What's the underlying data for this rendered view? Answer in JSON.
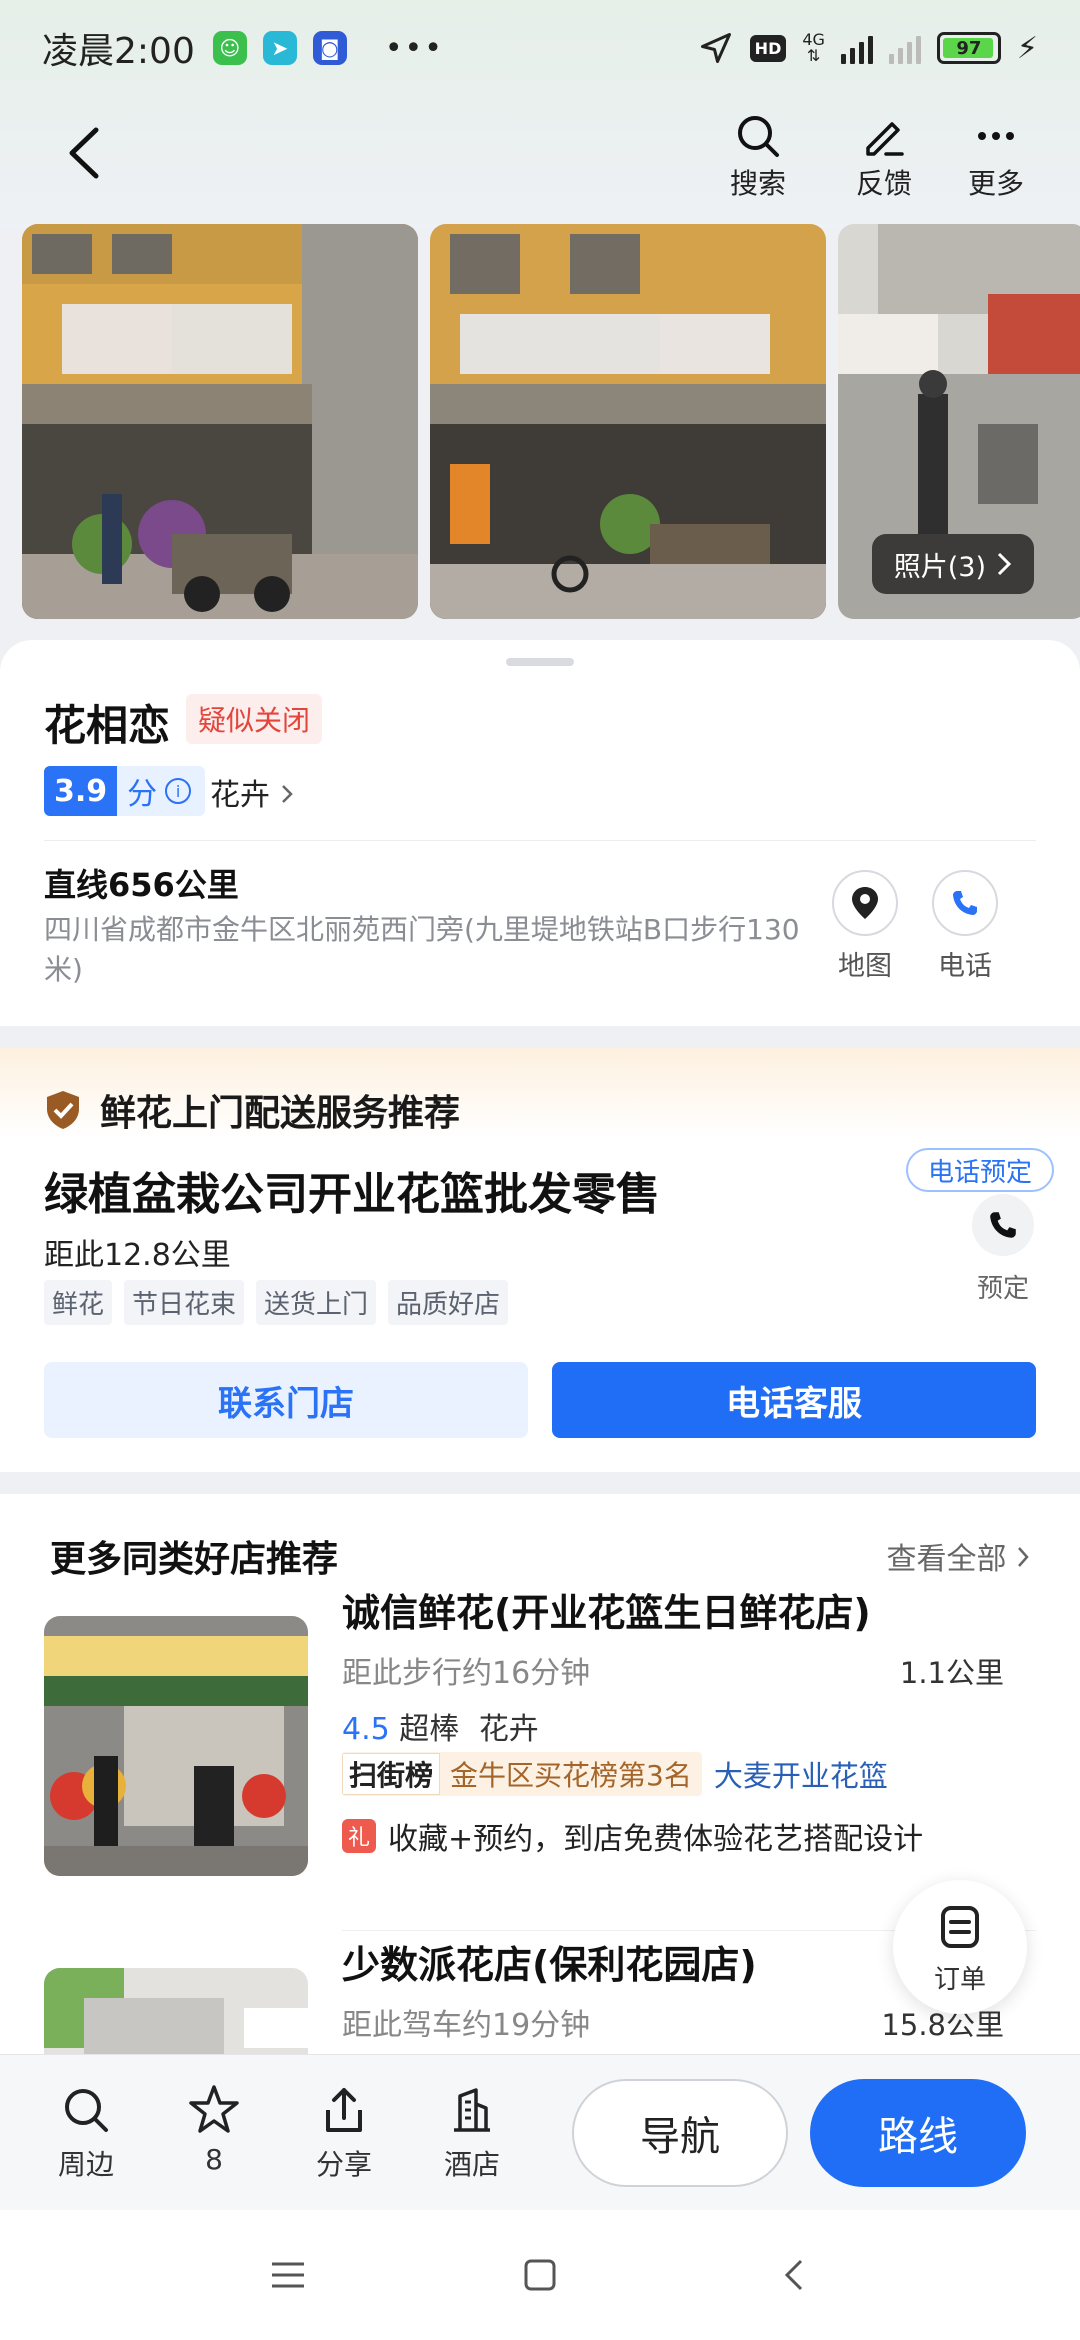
{
  "status_bar": {
    "time": "凌晨2:00",
    "more": "•••",
    "network": "4G",
    "hd": "HD",
    "battery": "97"
  },
  "header": {
    "actions": [
      {
        "label": "搜索",
        "icon": "search-icon"
      },
      {
        "label": "反馈",
        "icon": "edit-icon"
      },
      {
        "label": "更多",
        "icon": "more-icon"
      }
    ]
  },
  "photos": {
    "count_label": "照片(3)"
  },
  "place": {
    "name": "花相恋",
    "status_badge": "疑似关闭",
    "rating_score": "3.9",
    "rating_unit": "分",
    "category": "花卉",
    "distance": "直线656公里",
    "address": "四川省成都市金牛区北丽苑西门旁(九里堤地铁站B口步行130米)",
    "actions": [
      {
        "label": "地图",
        "icon": "location-pin-icon"
      },
      {
        "label": "电话",
        "icon": "phone-icon"
      }
    ]
  },
  "promo": {
    "header": "鲜花上门配送服务推荐",
    "title": "绿植盆栽公司开业花篮批发零售",
    "distance": "距此12.8公里",
    "tags": [
      "鲜花",
      "节日花束",
      "送货上门",
      "品质好店"
    ],
    "phone_reserve_badge": "电话预定",
    "reserve_label": "预定",
    "contact_button": "联系门店",
    "call_button": "电话客服"
  },
  "recommendations": {
    "title": "更多同类好店推荐",
    "view_all": "查看全部",
    "items": [
      {
        "name": "诚信鲜花(开业花篮生日鲜花店)",
        "subtitle": "距此步行约16分钟",
        "distance": "1.1公里",
        "score": "4.5",
        "score_label": "超棒",
        "category": "花卉",
        "rank_key": "扫街榜",
        "rank_value": "金牛区买花榜第3名",
        "rank_link": "大麦开业花篮",
        "gift_icon": "礼",
        "gift_text": "收藏+预约，到店免费体验花艺搭配设计"
      },
      {
        "name": "少数派花店(保利花园店)",
        "subtitle": "距此驾车约19分钟",
        "distance": "15.8公里"
      }
    ]
  },
  "orders_fab": {
    "label": "订单"
  },
  "bottom_bar": {
    "items": [
      {
        "label": "周边",
        "icon": "search-icon"
      },
      {
        "label": "8",
        "icon": "star-icon"
      },
      {
        "label": "分享",
        "icon": "share-icon"
      },
      {
        "label": "酒店",
        "icon": "hotel-icon"
      }
    ],
    "navigate_button": "导航",
    "route_button": "路线"
  }
}
